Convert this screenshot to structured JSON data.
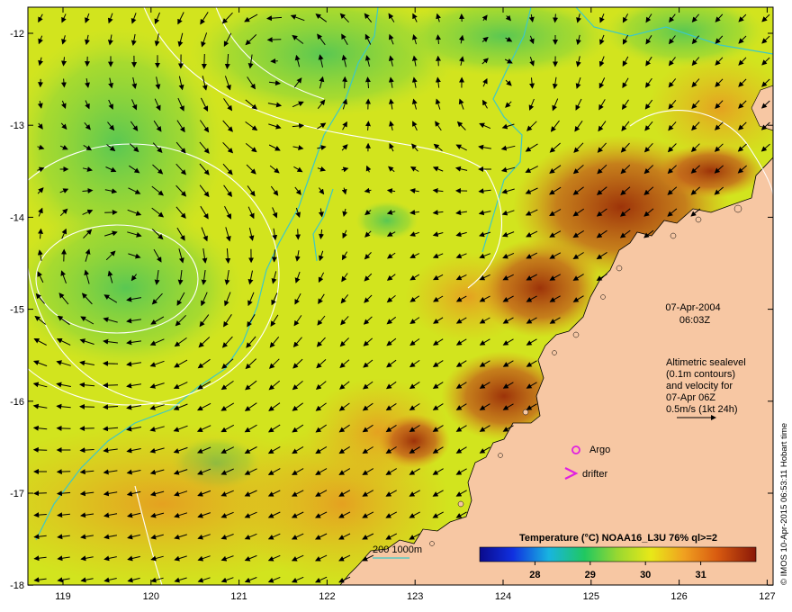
{
  "map": {
    "lon_ticks": [
      "119",
      "120",
      "121",
      "122",
      "123",
      "124",
      "125",
      "126",
      "127"
    ],
    "lat_ticks": [
      "-12",
      "-13",
      "-14",
      "-15",
      "-16",
      "-17",
      "-18"
    ],
    "date_line1": "07-Apr-2004",
    "date_line2": "06:03Z",
    "altimetry_lines": [
      "Altimetric sealevel",
      "(0.1m contours)",
      "and velocity for",
      "07-Apr 06Z",
      "0.5m/s (1kt 24h)"
    ],
    "argo_label": "Argo",
    "drifter_label": "drifter",
    "bathy_label": "200  1000m",
    "credit": "© IMOS 10-Apr-2015 06:53:11 Hobart time",
    "colors": {
      "land": "#f7c7a3",
      "warm_water": "#e08a1c",
      "hot_water": "#a8320c",
      "cool_water": "#8cd43a",
      "mid_water": "#d6e81c",
      "bathy_line": "#3cc8c8",
      "argo_marker": "#e020e0"
    }
  },
  "colorbar": {
    "title": "Temperature (°C) NOAA16_L3U 76% ql>=2",
    "ticks": [
      "28",
      "29",
      "30",
      "31"
    ],
    "min": 27,
    "max": 32
  }
}
